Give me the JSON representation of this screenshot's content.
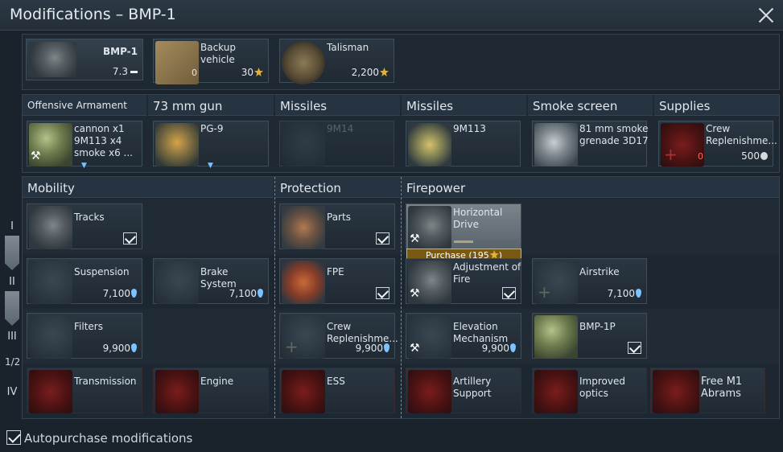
{
  "window": {
    "title": "Modifications – BMP-1"
  },
  "top": {
    "vehicle": {
      "name": "BMP-1",
      "br": "7.3"
    },
    "backup": {
      "label": "Backup\nvehicle",
      "count": "0",
      "price": "30"
    },
    "talisman": {
      "label": "Talisman",
      "price": "2,200"
    }
  },
  "weapons": {
    "headers": [
      "Offensive Armament",
      "73 mm gun",
      "Missiles",
      "Missiles",
      "Smoke screen",
      "Supplies"
    ],
    "items": [
      {
        "label": "cannon x1\n9M113 x4\nsmoke x6 ..."
      },
      {
        "label": "PG-9"
      },
      {
        "label": "9M14"
      },
      {
        "label": "9M113"
      },
      {
        "label": "81 mm smoke\ngrenade 3D17"
      },
      {
        "label": "Crew\nReplenishme...",
        "count": "0",
        "price": "500"
      }
    ]
  },
  "groups": {
    "mobility": "Mobility",
    "protection": "Protection",
    "firepower": "Firepower"
  },
  "tiers": [
    "I",
    "II",
    "III",
    "1/2",
    "IV"
  ],
  "mods": {
    "tracks": {
      "label": "Tracks"
    },
    "parts": {
      "label": "Parts"
    },
    "horizontal": {
      "label": "Horizontal\nDrive",
      "progress": 0.3
    },
    "suspension": {
      "label": "Suspension",
      "price": "7,100"
    },
    "brake": {
      "label": "Brake System",
      "price": "7,100"
    },
    "fpe": {
      "label": "FPE"
    },
    "adjust": {
      "label": "Adjustment of\nFire"
    },
    "airstrike": {
      "label": "Airstrike",
      "price": "7,100"
    },
    "filters": {
      "label": "Filters",
      "price": "9,900"
    },
    "crew": {
      "label": "Crew\nReplenishme...",
      "price": "9,900"
    },
    "elevation": {
      "label": "Elevation\nMechanism",
      "price": "9,900"
    },
    "bmp1p": {
      "label": "BMP-1P"
    },
    "transmission": {
      "label": "Transmission"
    },
    "engine": {
      "label": "Engine"
    },
    "ess": {
      "label": "ESS"
    },
    "artillery": {
      "label": "Artillery\nSupport"
    },
    "optics": {
      "label": "Improved\noptics"
    },
    "m1": {
      "label": "Free M1\nAbrams"
    }
  },
  "purchase": {
    "label": "Purchase (195",
    "suffix": ")"
  },
  "footer": {
    "autopurchase": "Autopurchase modifications"
  },
  "colors": {
    "gold": "#e1b13a",
    "rp": "#7dc3ff",
    "accent_border": "#e3b33c"
  }
}
